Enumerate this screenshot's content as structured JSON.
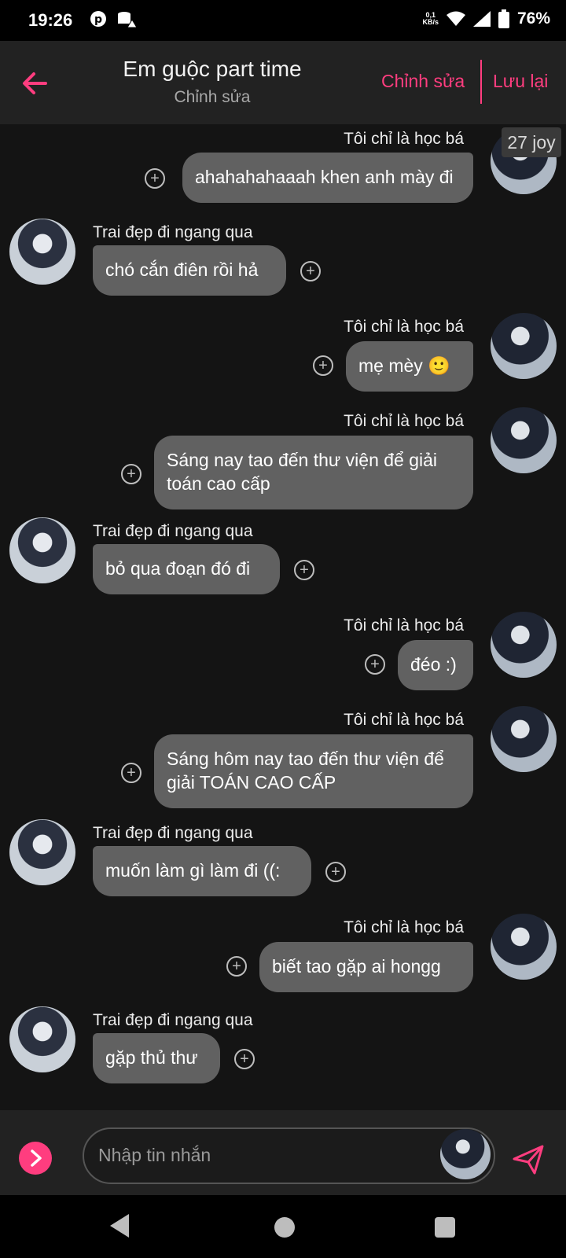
{
  "status_bar": {
    "time": "19:26",
    "speed_top": "0,1",
    "speed_bottom": "KB/s",
    "battery": "76%"
  },
  "header": {
    "title": "Em guộc part time",
    "subtitle": "Chỉnh sửa",
    "edit_label": "Chỉnh sửa",
    "save_label": "Lưu lại"
  },
  "overlay_badge": "27 joy",
  "messages": [
    {
      "sender": "Tôi chỉ là học bá",
      "text": "ahahahahaaah khen anh mày đi",
      "side": "right"
    },
    {
      "sender": "Trai đẹp đi ngang qua",
      "text": "chó cắn điên rồi hả",
      "side": "left"
    },
    {
      "sender": "Tôi chỉ là học bá",
      "text": "mẹ mèy 🙂",
      "side": "right"
    },
    {
      "sender": "Tôi chỉ là học bá",
      "text": "Sáng nay tao đến thư viện để giải toán cao cấp",
      "side": "right"
    },
    {
      "sender": "Trai đẹp đi ngang qua",
      "text": "bỏ qua đoạn đó đi",
      "side": "left"
    },
    {
      "sender": "Tôi chỉ là học bá",
      "text": "đéo :)",
      "side": "right"
    },
    {
      "sender": "Tôi chỉ là học bá",
      "text": "Sáng hôm nay tao đến thư viện để giải TOÁN CAO CẤP",
      "side": "right"
    },
    {
      "sender": "Trai đẹp đi ngang qua",
      "text": "muốn làm gì làm đi ((:",
      "side": "left"
    },
    {
      "sender": "Tôi chỉ là học bá",
      "text": "biết tao gặp ai hongg",
      "side": "right"
    },
    {
      "sender": "Trai đẹp đi ngang qua",
      "text": "gặp thủ thư",
      "side": "left"
    }
  ],
  "input": {
    "placeholder": "Nhập tin nhắn"
  },
  "colors": {
    "accent": "#ff3d7f",
    "bubble": "#616161",
    "background": "#141414",
    "header": "#222222"
  }
}
